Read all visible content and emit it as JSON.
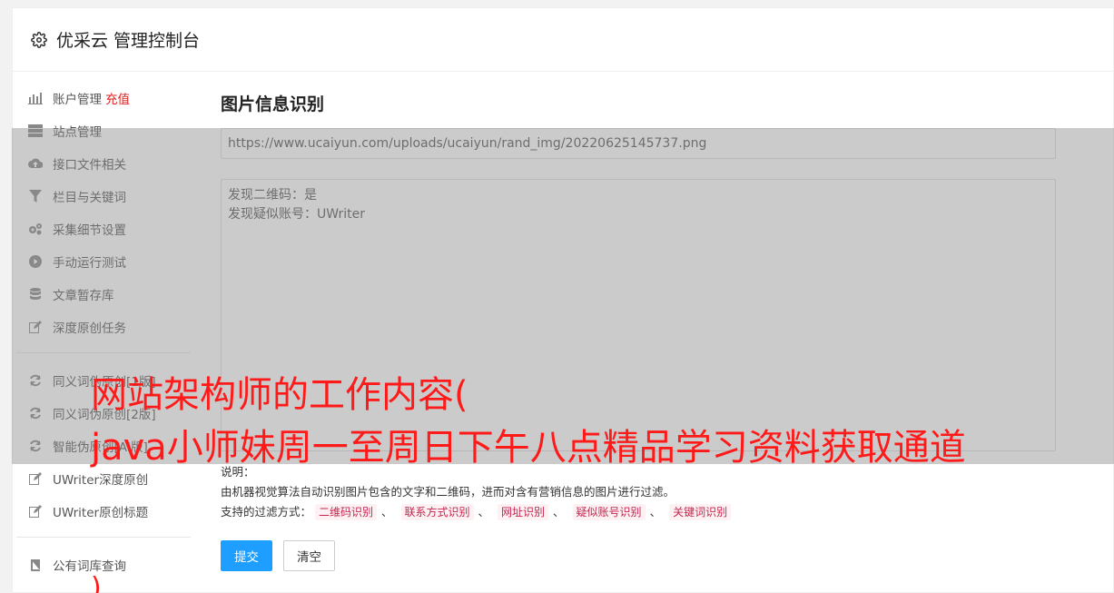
{
  "header": {
    "title": "优采云 管理控制台"
  },
  "sidebar": {
    "items": [
      {
        "label": "账户管理",
        "extra": "充值",
        "icon": "bar-chart-icon"
      },
      {
        "label": "站点管理",
        "icon": "server-icon"
      },
      {
        "label": "接口文件相关",
        "icon": "cloud-upload-icon"
      },
      {
        "label": "栏目与关键词",
        "icon": "filter-icon"
      },
      {
        "label": "采集细节设置",
        "icon": "gears-icon"
      },
      {
        "label": "手动运行测试",
        "icon": "play-circle-icon"
      },
      {
        "label": "文章暂存库",
        "icon": "database-icon"
      },
      {
        "label": "深度原创任务",
        "icon": "edit-icon"
      }
    ],
    "items2": [
      {
        "label": "同义词伪原创[1版]",
        "icon": "refresh-icon"
      },
      {
        "label": "同义词伪原创[2版]",
        "icon": "refresh-icon"
      },
      {
        "label": "智能伪原创[AI版]",
        "icon": "refresh-icon"
      },
      {
        "label": "UWriter深度原创",
        "icon": "edit-icon"
      },
      {
        "label": "UWriter原创标题",
        "icon": "edit-icon"
      }
    ],
    "items3": [
      {
        "label": "公有词库查询",
        "icon": "book-icon"
      }
    ]
  },
  "main": {
    "heading": "图片信息识别",
    "url_value": "https://www.ucaiyun.com/uploads/ucaiyun/rand_img/20220625145737.png",
    "result": "发现二维码：是\n发现疑似账号：UWriter",
    "desc_title": "说明：",
    "desc_text": "由机器视觉算法自动识别图片包含的文字和二维码，进而对含有营销信息的图片进行过滤。",
    "filter_label": "支持的过滤方式：",
    "filters": [
      "二维码识别",
      "联系方式识别",
      "网址识别",
      "疑似账号识别",
      "关键词识别"
    ],
    "filter_sep": "、",
    "submit_label": "提交",
    "clear_label": "清空"
  },
  "watermark": {
    "line1": "网站架构师的工作内容(",
    "line2": "java小师妹周一至周日下午八点精品学习资料获取通道",
    "line3": ")",
    "color": "#ff1a1a"
  }
}
